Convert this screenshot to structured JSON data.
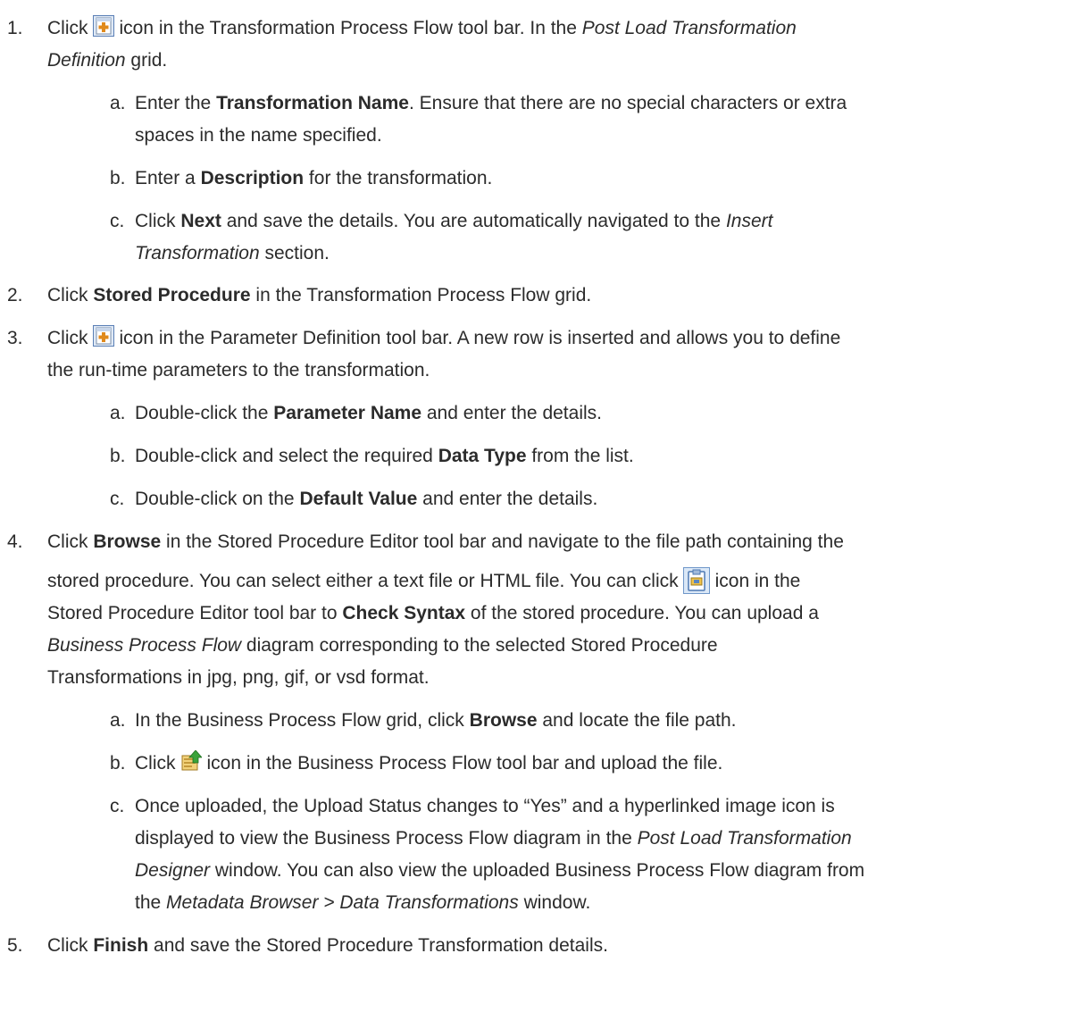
{
  "steps": [
    {
      "num": "1.",
      "line1_a": "Click",
      "line1_icon": "add-row-icon",
      "line1_b": "icon in the Transformation Process Flow tool bar. In the",
      "line1_i": "Post Load Transformation",
      "line2_i": "Definition",
      "line2_b": " grid.",
      "subs": [
        {
          "letter": "a.",
          "pre": "Enter the",
          "bold": "Transformation Name",
          "post": ". Ensure that there are no special characters or extra",
          "line2": "spaces in the name specified."
        },
        {
          "letter": "b.",
          "pre": "Enter a",
          "bold": "Description",
          "post": " for the transformation."
        },
        {
          "letter": "c.",
          "pre": "Click",
          "bold": "Next",
          "post": " and save the details. You are automatically navigated to the",
          "italic": "Insert",
          "line2_italic": "Transformation",
          "line2_post": " section."
        }
      ]
    },
    {
      "num": "2.",
      "pre": "Click",
      "bold": "Stored Procedure",
      "post": " in the Transformation Process Flow grid."
    },
    {
      "num": "3.",
      "pre": "Click",
      "icon": "add-row-icon",
      "post": "icon in the Parameter Definition tool bar. A new row is inserted and allows you to define",
      "line2": "the run-time parameters to the transformation.",
      "subs": [
        {
          "letter": "a.",
          "pre": "Double-click the",
          "bold": "Parameter Name",
          "post": " and enter the details."
        },
        {
          "letter": "b.",
          "pre": "Double-click and select the required",
          "bold": "Data Type",
          "post": " from the list."
        },
        {
          "letter": "c.",
          "pre": "Double-click on the",
          "bold": "Default Value",
          "post": " and enter the details."
        }
      ]
    },
    {
      "num": "4.",
      "pre": "Click",
      "bold": "Browse",
      "post": " in the Stored Procedure Editor tool bar and navigate to the file path containing the",
      "line2_pre": "stored procedure. You can select either a text file or HTML file. You can click",
      "line2_icon": "check-syntax-icon",
      "line2_post": "icon in the",
      "line3_pre": "Stored Procedure Editor tool bar to",
      "line3_bold": "Check Syntax",
      "line3_post": " of the stored procedure. You can upload a",
      "line4_italic": "Business Process Flow",
      "line4_post": " diagram corresponding to the selected Stored Procedure",
      "line5": "Transformations in jpg, png, gif, or vsd format.",
      "subs": [
        {
          "letter": "a.",
          "pre": "In the Business Process Flow grid, click",
          "bold": "Browse",
          "post": " and locate the file path."
        },
        {
          "letter": "b.",
          "pre": "Click",
          "icon": "upload-icon",
          "post": "icon in the Business Process Flow tool bar and upload the file."
        },
        {
          "letter": "c.",
          "l1": "Once uploaded, the Upload Status changes to “Yes” and a hyperlinked image icon is",
          "l2_pre": "displayed to view the Business Process Flow diagram in the",
          "l2_italic": "Post Load Transformation",
          "l3_italic": "Designer",
          "l3_post": " window. You can also view the uploaded Business Process Flow diagram from",
          "l4_pre": "the",
          "l4_italic": "Metadata Browser > Data Transformations",
          "l4_post": " window."
        }
      ]
    },
    {
      "num": "5.",
      "pre": "Click",
      "bold": "Finish",
      "post": " and save the Stored Procedure Transformation details."
    }
  ]
}
